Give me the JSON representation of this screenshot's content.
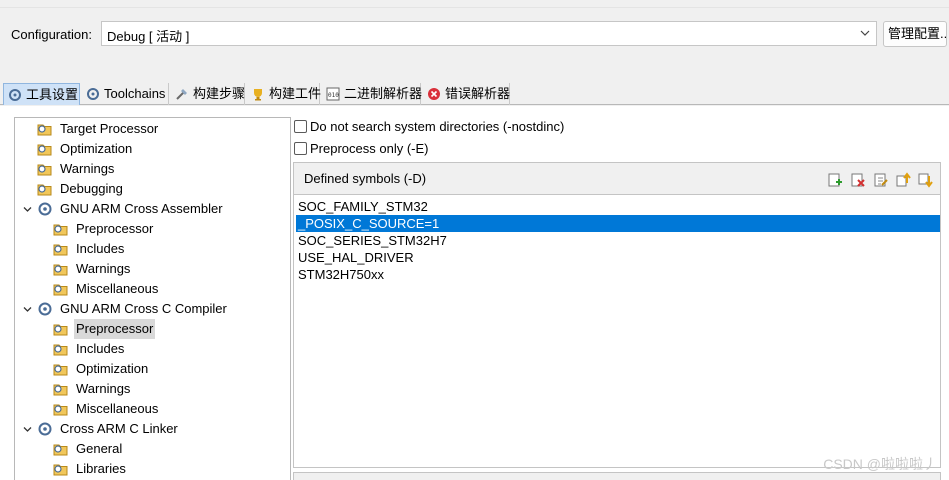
{
  "config": {
    "label": "Configuration:",
    "value": "Debug  [ 活动 ]",
    "manage_label": "管理配置..."
  },
  "tabs": [
    {
      "label": "工具设置",
      "icon": "tool-settings-icon",
      "active": true
    },
    {
      "label": "Toolchains",
      "icon": "toolchains-icon",
      "active": false
    },
    {
      "label": "构建步骤",
      "icon": "build-steps-icon",
      "active": false
    },
    {
      "label": "构建工件",
      "icon": "build-artifact-icon",
      "active": false
    },
    {
      "label": "二进制解析器",
      "icon": "binary-parser-icon",
      "active": false
    },
    {
      "label": "错误解析器",
      "icon": "error-parser-icon",
      "active": false
    }
  ],
  "tree": [
    {
      "label": "Target Processor",
      "level": 1
    },
    {
      "label": "Optimization",
      "level": 1
    },
    {
      "label": "Warnings",
      "level": 1
    },
    {
      "label": "Debugging",
      "level": 1
    },
    {
      "label": "GNU ARM Cross Assembler",
      "level": 0,
      "expanded": true
    },
    {
      "label": "Preprocessor",
      "level": 2
    },
    {
      "label": "Includes",
      "level": 2
    },
    {
      "label": "Warnings",
      "level": 2
    },
    {
      "label": "Miscellaneous",
      "level": 2
    },
    {
      "label": "GNU ARM Cross C Compiler",
      "level": 0,
      "expanded": true
    },
    {
      "label": "Preprocessor",
      "level": 2,
      "selected": true
    },
    {
      "label": "Includes",
      "level": 2
    },
    {
      "label": "Optimization",
      "level": 2
    },
    {
      "label": "Warnings",
      "level": 2
    },
    {
      "label": "Miscellaneous",
      "level": 2
    },
    {
      "label": "Cross ARM C Linker",
      "level": 0,
      "expanded": true
    },
    {
      "label": "General",
      "level": 2
    },
    {
      "label": "Libraries",
      "level": 2
    }
  ],
  "options": {
    "nostdinc_label": "Do not search system directories (-nostdinc)",
    "preprocess_label": "Preprocess only (-E)"
  },
  "symbols": {
    "title": "Defined symbols (-D)",
    "items": [
      "SOC_FAMILY_STM32",
      "_POSIX_C_SOURCE=1",
      "SOC_SERIES_STM32H7",
      "USE_HAL_DRIVER",
      "STM32H750xx"
    ],
    "selected_index": 1,
    "tools": [
      "add-icon",
      "delete-icon",
      "edit-icon",
      "move-up-icon",
      "move-down-icon"
    ]
  },
  "watermark": "CSDN @啦啦啦丿",
  "colors": {
    "selection": "#0078d7",
    "tab_active": "#cfe2f7",
    "tree_selection": "#d9d9d9"
  }
}
